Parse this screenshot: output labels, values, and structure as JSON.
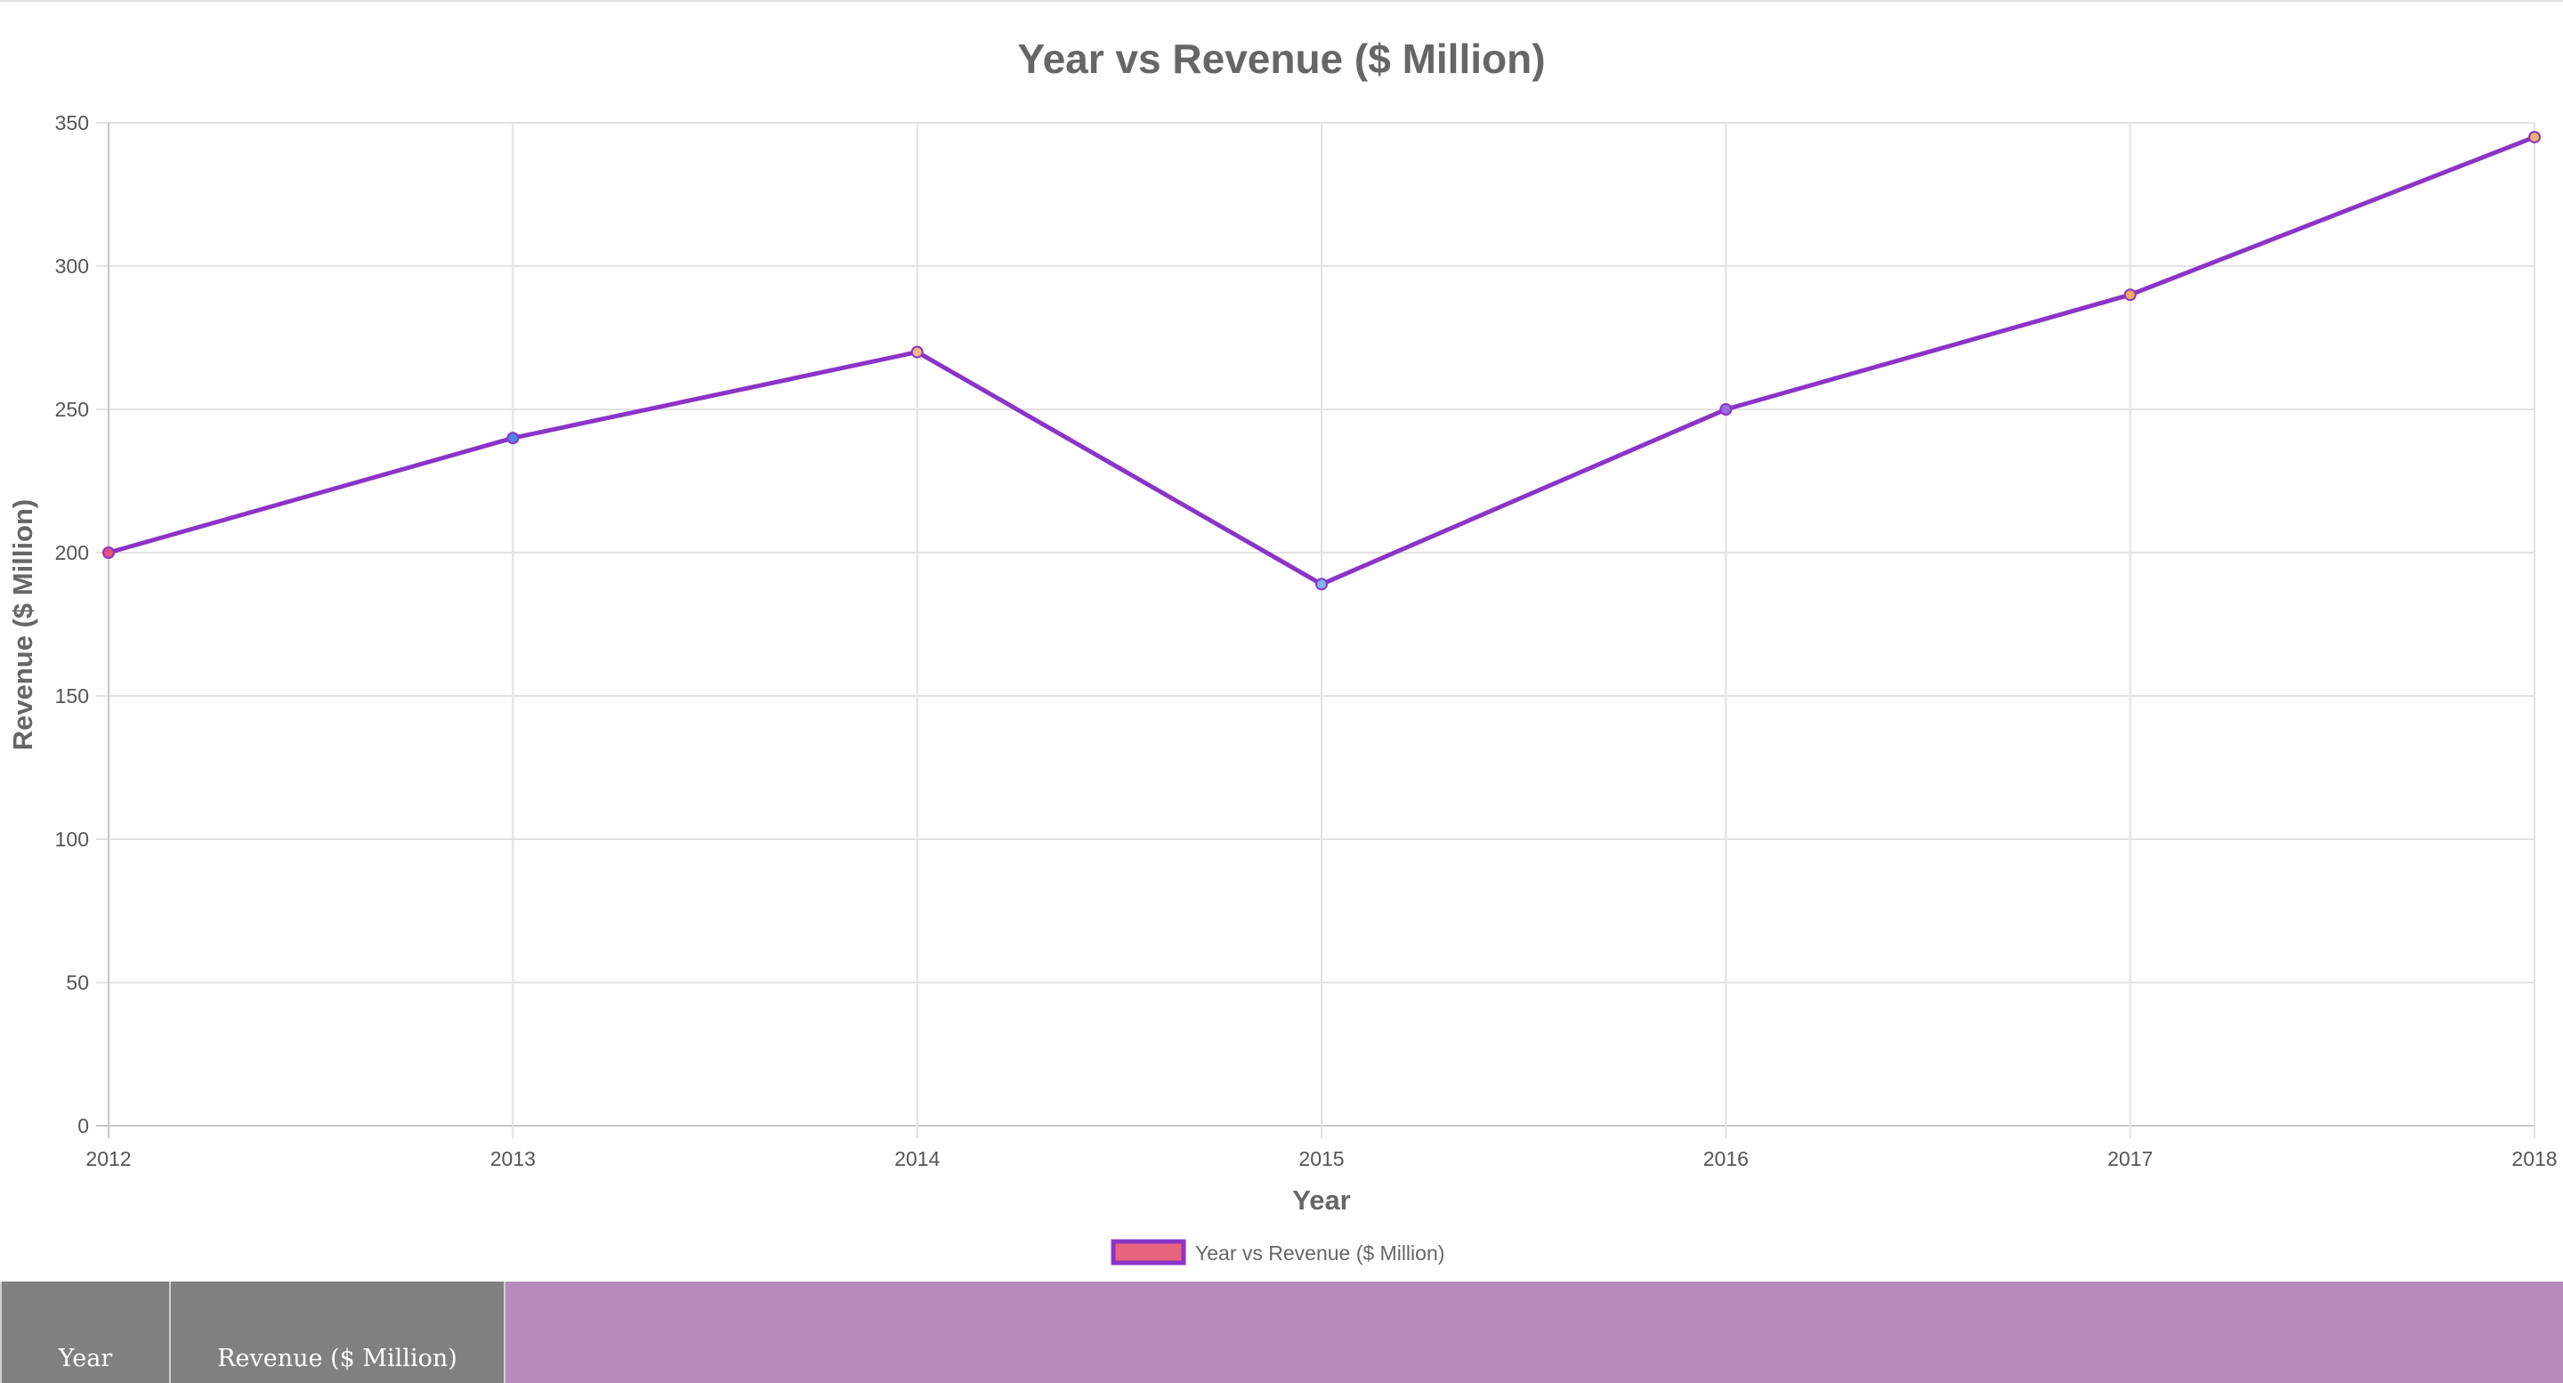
{
  "chart_data": {
    "type": "line",
    "title": "Year vs Revenue ($ Million)",
    "xlabel": "Year",
    "ylabel": "Revenue ($ Million)",
    "categories": [
      "2012",
      "2013",
      "2014",
      "2015",
      "2016",
      "2017",
      "2018"
    ],
    "series": [
      {
        "name": "Year vs Revenue ($ Million)",
        "values": [
          200,
          240,
          270,
          189,
          250,
          290,
          345
        ],
        "line_color": "#8b34c8",
        "legend_fill": "#e8647e",
        "point_colors": [
          "#e8527a",
          "#4a86e0",
          "#f5b880",
          "#7eb4f0",
          "#9b6fe0",
          "#f4a860",
          "#f0b070"
        ]
      }
    ],
    "ylim": [
      0,
      350
    ],
    "yticks": [
      0,
      50,
      100,
      150,
      200,
      250,
      300,
      350
    ],
    "grid": true,
    "legend_position": "bottom"
  },
  "table": {
    "headers": [
      "Year",
      "Revenue ($ Million)"
    ],
    "background_color": "#b68cbb",
    "header_color": "#808080"
  }
}
